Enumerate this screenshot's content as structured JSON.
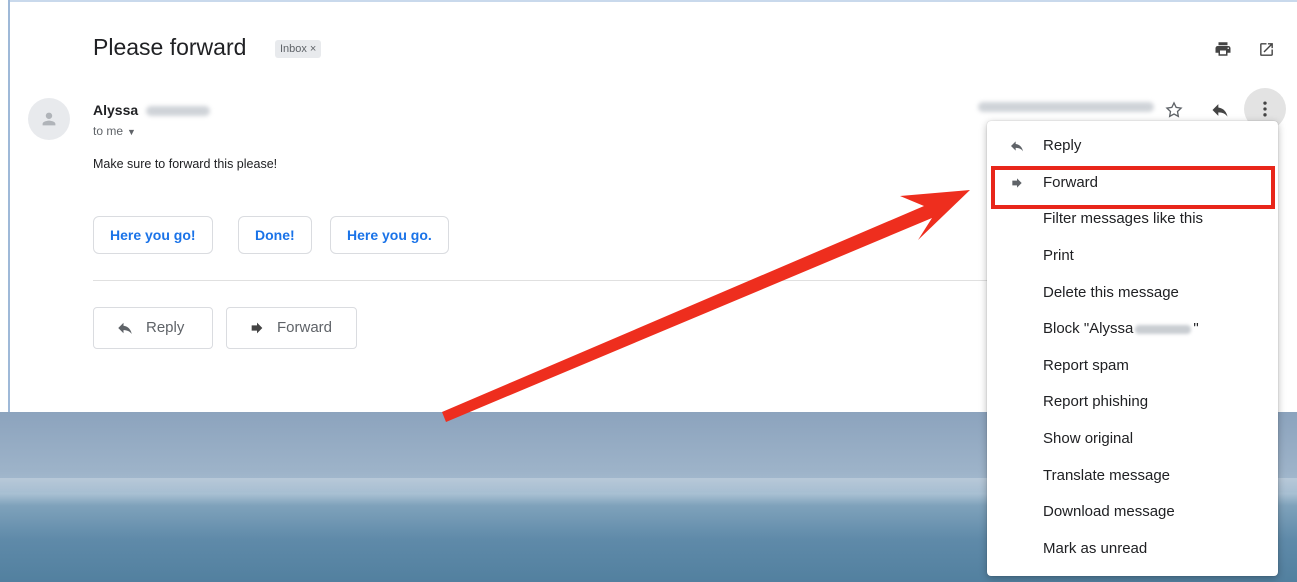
{
  "email": {
    "subject": "Please forward",
    "label_chip": "Inbox",
    "label_chip_close": "×",
    "sender_name": "Alyssa",
    "recipient_label": "to me",
    "body": "Make sure to forward this please!"
  },
  "smart_replies": [
    "Here you go!",
    "Done!",
    "Here you go."
  ],
  "actions": {
    "reply_label": "Reply",
    "forward_label": "Forward"
  },
  "menu": {
    "items": [
      {
        "label": "Reply",
        "icon": "reply-icon"
      },
      {
        "label": "Forward",
        "icon": "forward-icon"
      },
      {
        "label": "Filter messages like this"
      },
      {
        "label": "Print"
      },
      {
        "label": "Delete this message"
      },
      {
        "label_prefix": "Block \"Alyssa",
        "label_suffix": "\""
      },
      {
        "label": "Report spam"
      },
      {
        "label": "Report phishing"
      },
      {
        "label": "Show original"
      },
      {
        "label": "Translate message"
      },
      {
        "label": "Download message"
      },
      {
        "label": "Mark as unread"
      }
    ]
  },
  "icons": [
    "print-icon",
    "open-in-new-window-icon",
    "star-icon",
    "reply-icon",
    "more-vertical-icon",
    "person-icon",
    "chevron-down-icon",
    "forward-icon"
  ],
  "colors": {
    "accent_blue": "#1a73e8",
    "annotation_red": "#e8261a",
    "menu_hover": "#ffffff"
  }
}
